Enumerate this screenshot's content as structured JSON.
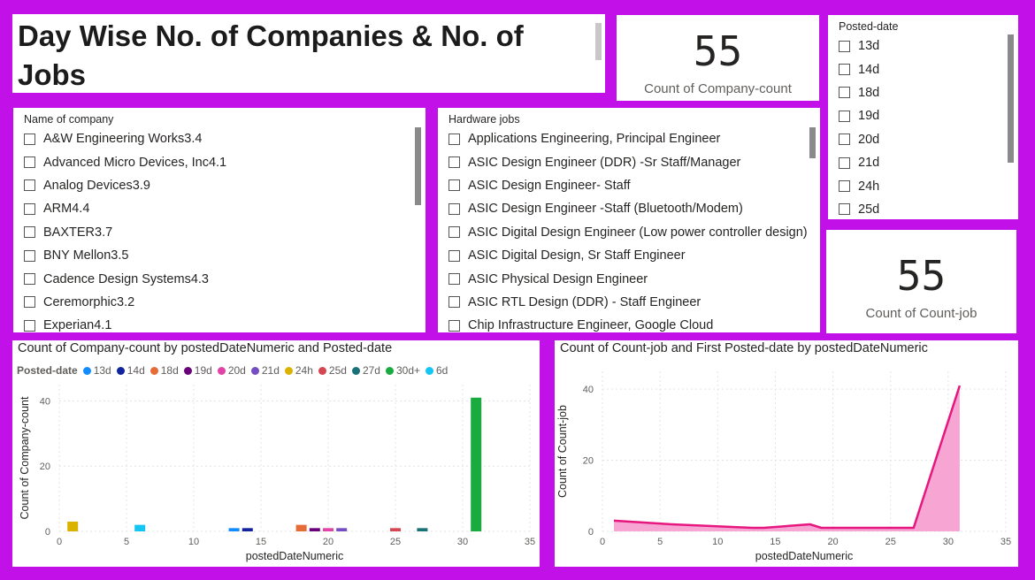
{
  "title": "Day Wise No. of Companies & No. of Jobs",
  "kpi_company": {
    "value": "55",
    "label": "Count of Company-count"
  },
  "kpi_jobs": {
    "value": "55",
    "label": "Count of Count-job"
  },
  "company_slicer": {
    "header": "Name of company",
    "items": [
      "A&W Engineering Works3.4",
      "Advanced Micro Devices, Inc4.1",
      "Analog Devices3.9",
      "ARM4.4",
      "BAXTER3.7",
      "BNY Mellon3.5",
      "Cadence Design Systems4.3",
      "Ceremorphic3.2",
      "Experian4.1"
    ]
  },
  "jobs_slicer": {
    "header": "Hardware jobs",
    "items": [
      "Applications Engineering, Principal Engineer",
      "ASIC Design Engineer (DDR) -Sr Staff/Manager",
      "ASIC Design Engineer- Staff",
      "ASIC Design Engineer -Staff (Bluetooth/Modem)",
      "ASIC Digital Design Engineer (Low power controller design)",
      "ASIC Digital Design, Sr Staff Engineer",
      "ASIC Physical Design Engineer",
      "ASIC RTL Design (DDR) - Staff Engineer",
      "Chip Infrastructure Engineer, Google Cloud"
    ]
  },
  "date_slicer": {
    "header": "Posted-date",
    "items": [
      "13d",
      "14d",
      "18d",
      "19d",
      "20d",
      "21d",
      "24h",
      "25d"
    ]
  },
  "chart_data": [
    {
      "type": "bar",
      "title": "Count of Company-count by postedDateNumeric and Posted-date",
      "xlabel": "postedDateNumeric",
      "ylabel": "Count of Company-count",
      "xlim": [
        0,
        35
      ],
      "ylim": [
        0,
        45
      ],
      "xticks": [
        0,
        5,
        10,
        15,
        20,
        25,
        30,
        35
      ],
      "yticks": [
        0,
        20,
        40
      ],
      "grid": true,
      "legend_title": "Posted-date",
      "legend_position": "top-left",
      "series": [
        {
          "name": "13d",
          "color": "#118dff",
          "x": 13,
          "value": 1
        },
        {
          "name": "14d",
          "color": "#12239e",
          "x": 14,
          "value": 1
        },
        {
          "name": "18d",
          "color": "#e66c37",
          "x": 18,
          "value": 2
        },
        {
          "name": "19d",
          "color": "#6b007b",
          "x": 19,
          "value": 1
        },
        {
          "name": "20d",
          "color": "#e044a7",
          "x": 20,
          "value": 1
        },
        {
          "name": "21d",
          "color": "#744ec2",
          "x": 21,
          "value": 1
        },
        {
          "name": "24h",
          "color": "#d9b300",
          "x": 1,
          "value": 3
        },
        {
          "name": "25d",
          "color": "#d64550",
          "x": 25,
          "value": 1
        },
        {
          "name": "27d",
          "color": "#197278",
          "x": 27,
          "value": 1
        },
        {
          "name": "30d+",
          "color": "#1aab40",
          "x": 31,
          "value": 41
        },
        {
          "name": "6d",
          "color": "#15c6f4",
          "x": 6,
          "value": 2
        }
      ]
    },
    {
      "type": "area",
      "title": "Count of Count-job and First Posted-date by postedDateNumeric",
      "xlabel": "postedDateNumeric",
      "ylabel": "Count of Count-job",
      "xlim": [
        0,
        35
      ],
      "ylim": [
        0,
        45
      ],
      "xticks": [
        0,
        5,
        10,
        15,
        20,
        25,
        30,
        35
      ],
      "yticks": [
        0,
        20,
        40
      ],
      "grid": true,
      "color": "#e6177f",
      "fill": "#f7a6d3",
      "x": [
        1,
        6,
        13,
        14,
        18,
        19,
        20,
        21,
        25,
        27,
        31
      ],
      "y": [
        3,
        2,
        1,
        1,
        2,
        1,
        1,
        1,
        1,
        1,
        41
      ]
    }
  ]
}
